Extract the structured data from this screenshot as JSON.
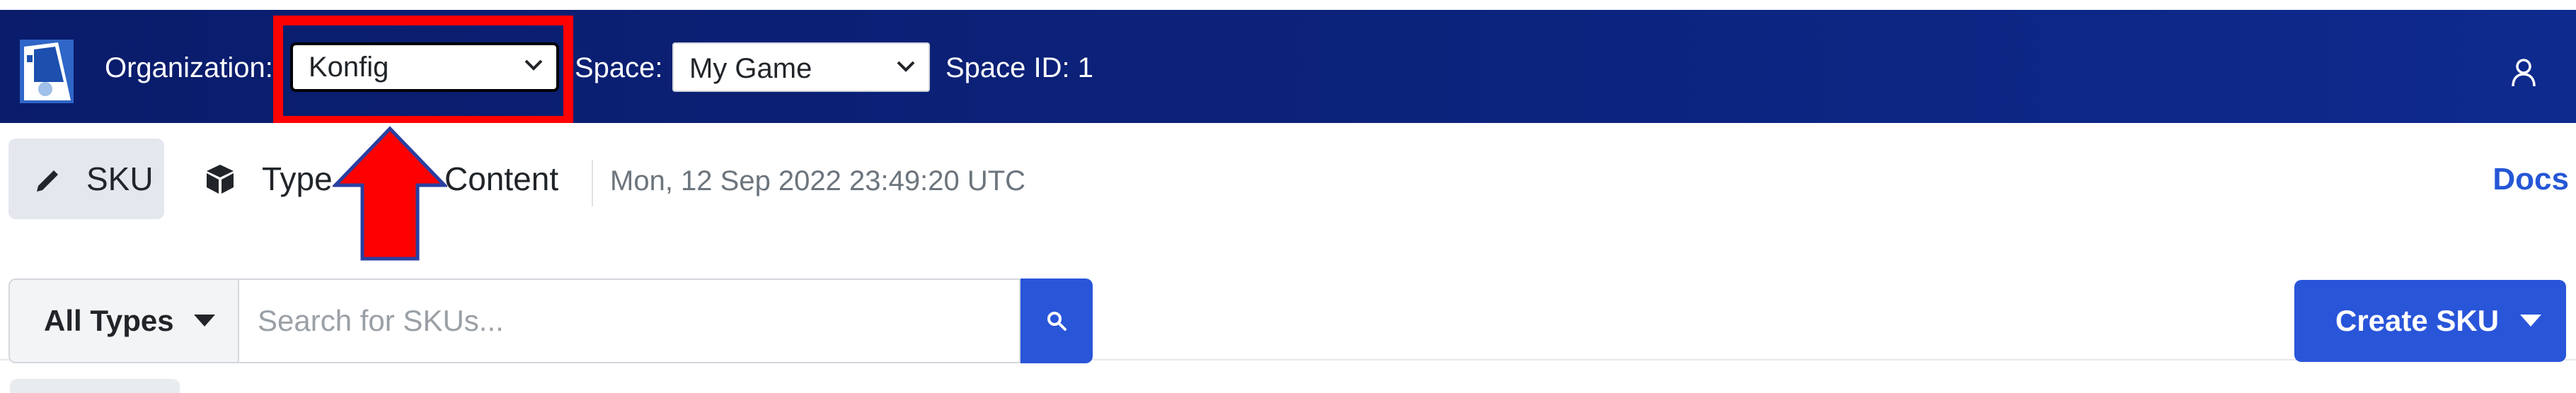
{
  "header": {
    "organization_label": "Organization:",
    "organization_value": "Konfig",
    "space_label": "Space:",
    "space_value": "My Game",
    "space_id": "Space ID: 1"
  },
  "nav": {
    "sku_label": "SKU",
    "type_label": "Type",
    "content_label": "Content",
    "timestamp": "Mon, 12 Sep 2022 23:49:20 UTC",
    "docs_label": "Docs"
  },
  "toolbar": {
    "type_filter_label": "All Types",
    "search_placeholder": "Search for SKUs...",
    "create_label": "Create SKU"
  },
  "icons": {
    "logo": "konfig-logo",
    "user": "user-icon",
    "sku": "pencil-icon",
    "type": "cube-icon",
    "content": "list-icon",
    "search": "search-icon",
    "caret": "caret-down-icon"
  },
  "colors": {
    "header_bg": "#0c237c",
    "accent": "#2955d9",
    "highlight": "#ff0000",
    "docs_link": "#2557d6"
  }
}
